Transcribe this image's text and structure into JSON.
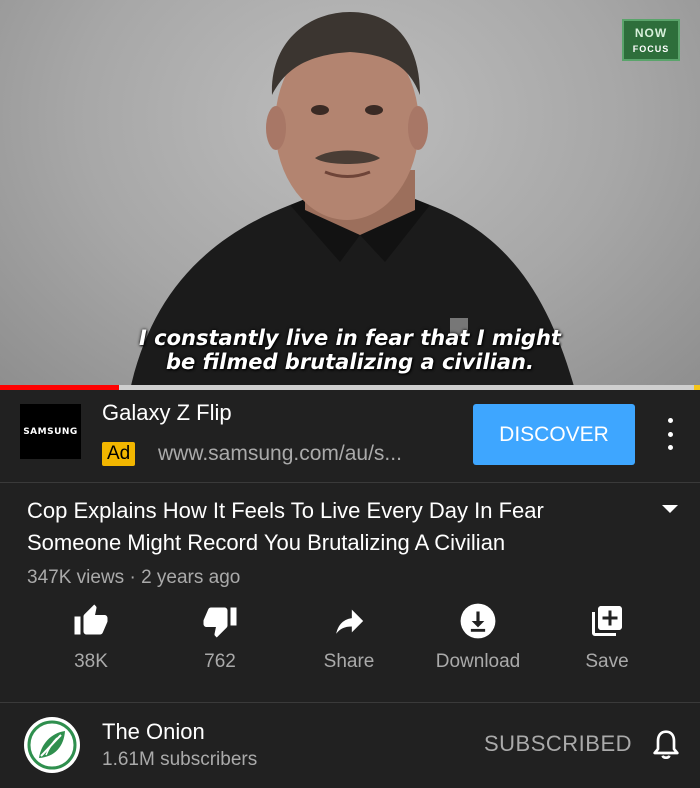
{
  "video": {
    "caption_line1": "I constantly live in fear that I might",
    "caption_line2": "be filmed brutalizing a civilian.",
    "badge_top": "NOW",
    "badge_bottom": "FOCUS",
    "progress": 0.17
  },
  "ad": {
    "logo_text": "SAMSUNG",
    "title": "Galaxy Z Flip",
    "tag": "Ad",
    "url": "www.samsung.com/au/s...",
    "cta": "DISCOVER",
    "menu_icon": "more-vert-icon"
  },
  "info": {
    "title": "Cop Explains How It Feels To Live Every Day In Fear Someone Might Record You Brutalizing A Civilian",
    "views": "347K views",
    "separator": "·",
    "age": "2 years ago",
    "expand_icon": "chevron-down-icon"
  },
  "actions": [
    {
      "label": "38K",
      "icon": "thumb-up-icon"
    },
    {
      "label": "762",
      "icon": "thumb-down-icon"
    },
    {
      "label": "Share",
      "icon": "share-icon"
    },
    {
      "label": "Download",
      "icon": "download-icon"
    },
    {
      "label": "Save",
      "icon": "playlist-add-icon"
    }
  ],
  "channel": {
    "name": "The Onion",
    "subscribers": "1.61M subscribers",
    "subscribe_state": "SUBSCRIBED",
    "avatar_icon": "onion-logo-icon",
    "bell_icon": "bell-icon"
  },
  "colors": {
    "background": "#212121",
    "accent_blue": "#3ea6ff",
    "progress_red": "#ff0000",
    "ad_badge": "#f2b600",
    "secondary_text": "#aaaaaa"
  }
}
